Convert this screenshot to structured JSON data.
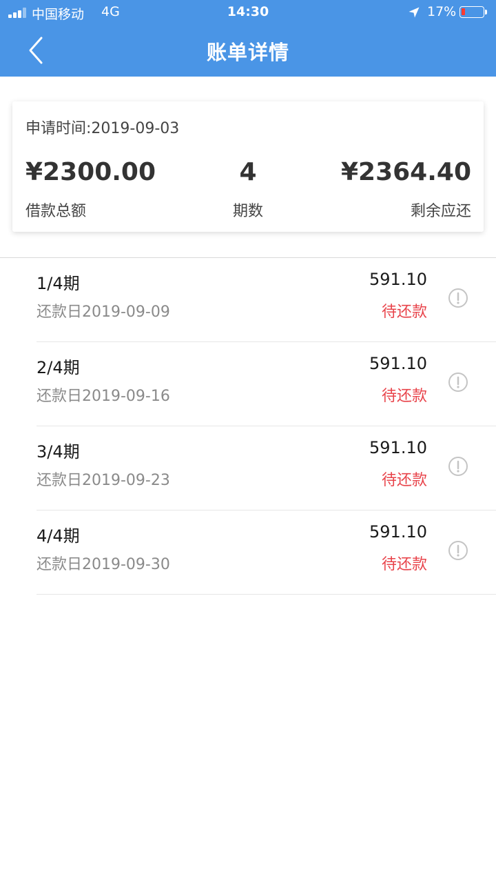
{
  "status_bar": {
    "carrier": "中国移动",
    "network": "4G",
    "time": "14:30",
    "battery": "17%",
    "battery_level": 0.17,
    "icons": [
      "signal-icon",
      "location-icon",
      "battery-icon"
    ]
  },
  "nav": {
    "back_icon": "chevron-left-icon",
    "title": "账单详情"
  },
  "summary": {
    "apply_date": "申请时间:2019-09-03",
    "total_amount": "¥2300.00",
    "total_label": "借款总额",
    "periods": "4",
    "periods_label": "期数",
    "remaining": "¥2364.40",
    "remaining_label": "剩余应还"
  },
  "installments": [
    {
      "period": "1/4期",
      "due_date": "还款日2019-09-09",
      "amount": "591.10",
      "status": "待还款"
    },
    {
      "period": "2/4期",
      "due_date": "还款日2019-09-16",
      "amount": "591.10",
      "status": "待还款"
    },
    {
      "period": "3/4期",
      "due_date": "还款日2019-09-23",
      "amount": "591.10",
      "status": "待还款"
    },
    {
      "period": "4/4期",
      "due_date": "还款日2019-09-30",
      "amount": "591.10",
      "status": "待还款"
    }
  ],
  "colors": {
    "header": "#4a95e6",
    "status_pending": "#e8434a",
    "battery_low": "#ff3b30"
  }
}
